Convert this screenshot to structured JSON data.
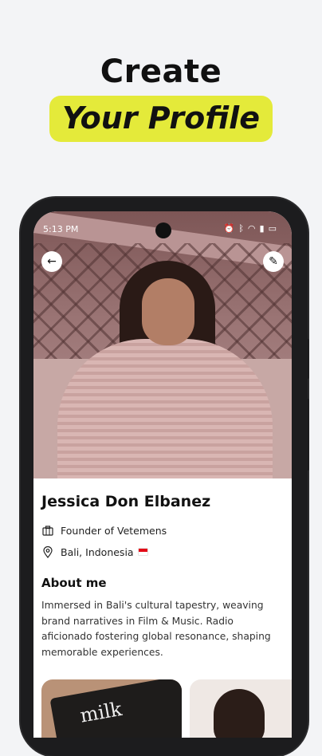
{
  "headline": {
    "line1": "Create",
    "line2": "Your Profile",
    "highlight_color": "#e4ea3a"
  },
  "status_bar": {
    "time": "5:13 PM",
    "icons": [
      "alarm-icon",
      "bluetooth-icon",
      "wifi-icon",
      "signal-icon",
      "battery-icon"
    ]
  },
  "toolbar": {
    "back_icon": "arrow-left-icon",
    "edit_icon": "pencil-icon"
  },
  "profile": {
    "name": "Jessica Don Elbanez",
    "occupation": "Founder of Vetemens",
    "location": "Bali, Indonesia",
    "about_title": "About me",
    "about_text": "Immersed in Bali's cultural tapestry, weaving brand narratives in Film & Music. Radio aficionado fostering global resonance, shaping memorable experiences."
  },
  "gallery": {
    "thumb1_text": "milk"
  }
}
